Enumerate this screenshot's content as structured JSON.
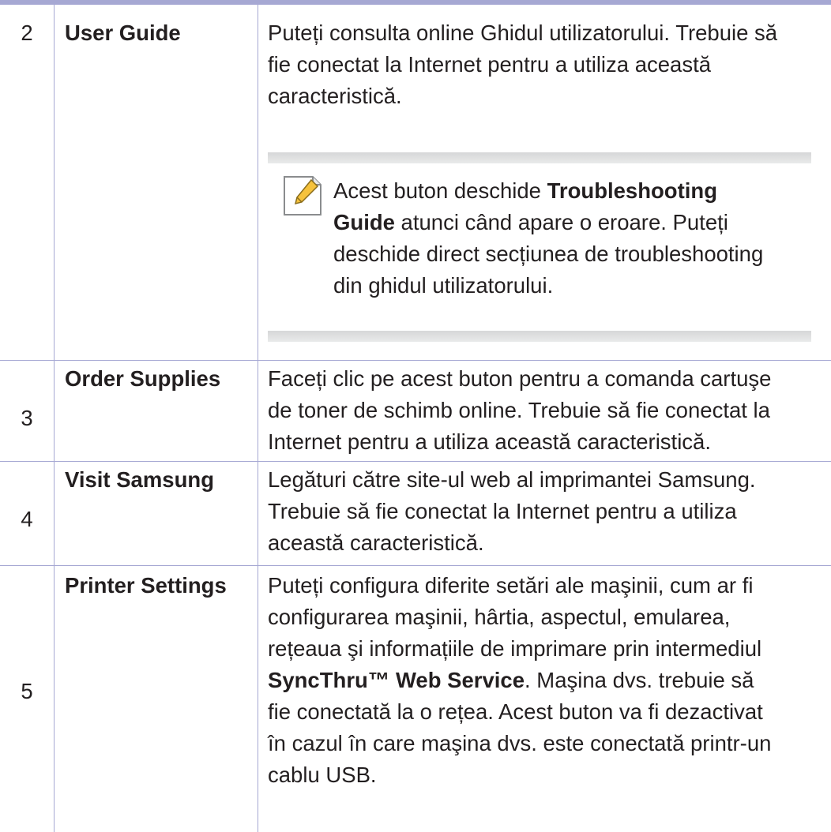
{
  "rows": [
    {
      "num": "2",
      "name": "User Guide",
      "desc_lines": [
        "Puteți consulta online Ghidul utilizatorului. Trebuie să",
        "fie conectat la Internet pentru a utiliza această",
        "caracteristică."
      ],
      "note": {
        "icon": "note-pencil-icon",
        "line1_a": "Acest buton deschide ",
        "line1_b": "Troubleshooting",
        "line2_a": "Guide",
        "line2_b": " atunci când apare o eroare. Puteți",
        "line3": "deschide direct secțiunea de troubleshooting",
        "line4": "din ghidul utilizatorului."
      }
    },
    {
      "num": "3",
      "name": "Order Supplies",
      "desc_lines": [
        "Faceți clic pe acest buton pentru a comanda cartuşe",
        "de toner de schimb online. Trebuie să fie conectat la",
        "Internet pentru a utiliza această caracteristică."
      ]
    },
    {
      "num": "4",
      "name": "Visit Samsung",
      "desc_lines": [
        "Legături către site-ul web al imprimantei Samsung.",
        "Trebuie să fie conectat la Internet pentru a utiliza",
        "această caracteristică."
      ]
    },
    {
      "num": "5",
      "name": "Printer Settings",
      "desc_lines": [
        "Puteți configura diferite setări ale maşinii, cum ar fi",
        "configurarea maşinii, hârtia, aspectul, emularea,",
        "rețeaua şi informațiile de imprimare prin intermediul"
      ],
      "desc_bold_line_a": "SyncThru™ Web Service",
      "desc_bold_line_b": ". Maşina dvs. trebuie să",
      "desc_tail_lines": [
        "fie conectată la o rețea. Acest buton va fi dezactivat",
        "în cazul în care maşina dvs. este conectată printr-un",
        "cablu USB."
      ]
    }
  ],
  "colors": {
    "rule": "#a6a8d3",
    "note_bar": "#d6d7d8",
    "text": "#231f20"
  }
}
